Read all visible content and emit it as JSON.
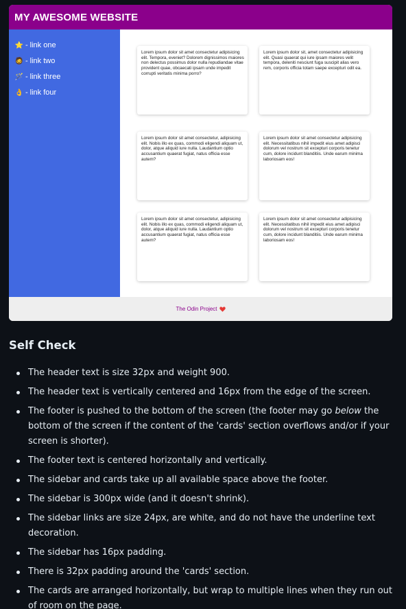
{
  "screenshot": {
    "header": {
      "title": "MY AWESOME WEBSITE",
      "bg": "#8b008b"
    },
    "sidebar": {
      "bg": "#4169e1",
      "links": [
        {
          "emoji": "⭐",
          "dash": "-",
          "label": "link one"
        },
        {
          "emoji": "🧔",
          "dash": "-",
          "label": "link two"
        },
        {
          "emoji": "🪄",
          "dash": "-",
          "label": "link three"
        },
        {
          "emoji": "👌",
          "dash": "-",
          "label": "link four"
        }
      ]
    },
    "cards": [
      {
        "text": "Lorem ipsum dolor sit amet consectetur adipisicing elit. Tempora, eveniet? Dolorem dignissimos maiores non delectus possimus dolor nulla repudiandae vitae provident quae, obcaecati ipsam unde impedit corrupti veritatis minima porro?"
      },
      {
        "text": "Lorem ipsum dolor sit, amet consectetur adipisicing elit. Quasi quaerat qui iure ipsam maiores velit tempora, deleniti nesciunt fuga suscipit alias vero rem, corporis officia totam saepe excepturi odit ea."
      },
      {
        "text": "Lorem ipsum dolor sit amet consectetur, adipisicing elit. Nobis illo ex quas, commodi eligendi aliquam ut, dolor, atque aliquid iure nulla. Laudantium optio accusantium quaerat fugiat, natus officia esse autem?"
      },
      {
        "text": "Lorem ipsum dolor sit amet consectetur adipisicing elit. Necessitatibus nihil impedit eius amet adipisci dolorum vel nostrum sit excepturi corporis tenetur cum, dolore incidunt blanditiis. Unde earum minima laboriosam eos!"
      },
      {
        "text": "Lorem ipsum dolor sit amet consectetur, adipisicing elit. Nobis illo ex quas, commodi eligendi aliquam ut, dolor, atque aliquid iure nulla. Laudantium optio accusantium quaerat fugiat, natus officia esse autem?"
      },
      {
        "text": "Lorem ipsum dolor sit amet consectetur adipisicing elit. Necessitatibus nihil impedit eius amet adipisci dolorum vel nostrum sit excepturi corporis tenetur cum, dolore incidunt blanditiis. Unde earum minima laboriosam eos!"
      }
    ],
    "footer": {
      "text": "The Odin Project",
      "icon": "heart-icon",
      "color": "#8b008b"
    }
  },
  "self_check": {
    "title": "Self Check",
    "items": [
      {
        "text": "The header text is size 32px and weight 900."
      },
      {
        "text": "The header text is vertically centered and 16px from the edge of the screen."
      },
      {
        "before": "The footer is pushed to the bottom of the screen (the footer may go ",
        "em": "below",
        "after": " the bottom of the screen if the content of the 'cards' section overflows and/or if your screen is shorter)."
      },
      {
        "text": "The footer text is centered horizontally and vertically."
      },
      {
        "text": "The sidebar and cards take up all available space above the footer."
      },
      {
        "text": "The sidebar is 300px wide (and it doesn't shrink)."
      },
      {
        "text": "The sidebar links are size 24px, are white, and do not have the underline text decoration."
      },
      {
        "text": "The sidebar has 16px padding."
      },
      {
        "text": "There is 32px padding around the 'cards' section."
      },
      {
        "text": "The cards are arranged horizontally, but wrap to multiple lines when they run out of room on the page."
      }
    ]
  }
}
